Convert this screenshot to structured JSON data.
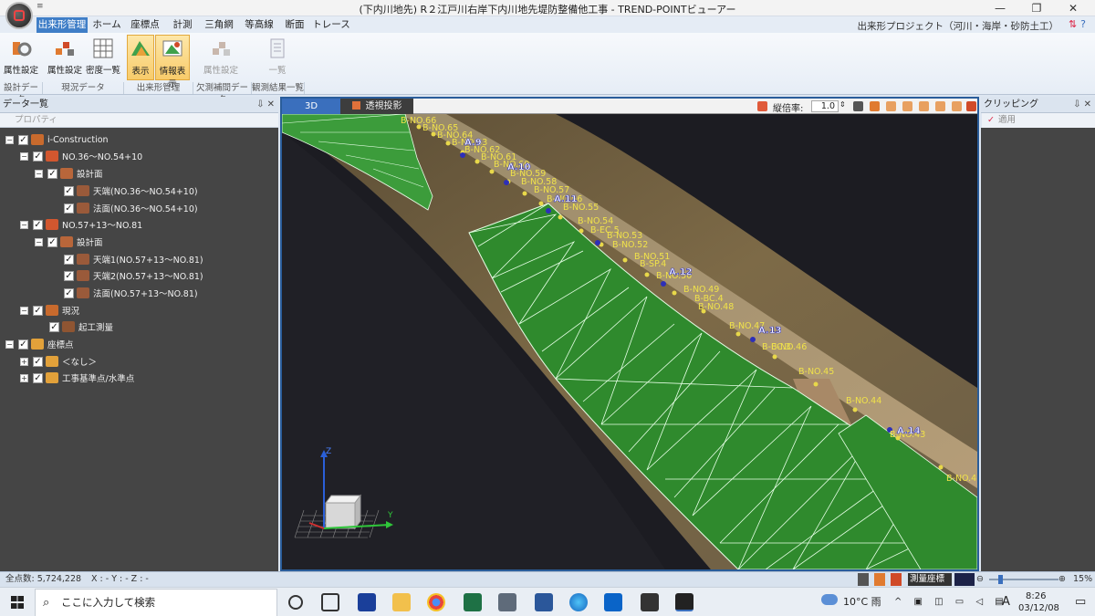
{
  "window": {
    "title": "(下内川地先) R２江戸川右岸下内川地先堤防整備他工事 - TREND-POINTビューアー",
    "qat": "≡",
    "controls": [
      "—",
      "❐",
      "✕"
    ]
  },
  "ribbon_tabs": [
    "出来形管理",
    "ホーム",
    "座標点",
    "計測",
    "三角網",
    "等高線",
    "断面",
    "トレース"
  ],
  "project_label": "出来形プロジェクト（河川・海岸・砂防土工）",
  "ribbon_groups": [
    {
      "label": "設計データ",
      "buttons": [
        "属性設定"
      ]
    },
    {
      "label": "現況データ",
      "buttons": [
        "属性設定",
        "密度一覧"
      ]
    },
    {
      "label": "出来形管理",
      "buttons": [
        "表示",
        "情報表示"
      ]
    },
    {
      "label": "欠測補間データ",
      "buttons": [
        "属性設定"
      ]
    },
    {
      "label": "観測結果一覧",
      "buttons": [
        "一覧"
      ]
    }
  ],
  "left_panel": {
    "title": "データ一覧",
    "subtitle": "プロパティ",
    "tree": [
      {
        "label": "i-Construction",
        "level": 0,
        "expander": "−"
      },
      {
        "label": "NO.36～NO.54+10",
        "level": 1,
        "expander": "−"
      },
      {
        "label": "設計面",
        "level": 2,
        "expander": "−"
      },
      {
        "label": "天端(NO.36～NO.54+10)",
        "level": 3,
        "expander": ""
      },
      {
        "label": "法面(NO.36～NO.54+10)",
        "level": 3,
        "expander": ""
      },
      {
        "label": "NO.57+13～NO.81",
        "level": 1,
        "expander": "−"
      },
      {
        "label": "設計面",
        "level": 2,
        "expander": "−"
      },
      {
        "label": "天端1(NO.57+13～NO.81)",
        "level": 3,
        "expander": ""
      },
      {
        "label": "天端2(NO.57+13～NO.81)",
        "level": 3,
        "expander": ""
      },
      {
        "label": "法面(NO.57+13～NO.81)",
        "level": 3,
        "expander": ""
      },
      {
        "label": "現況",
        "level": 1,
        "expander": "−"
      },
      {
        "label": "起工測量",
        "level": 2,
        "expander": ""
      },
      {
        "label": "座標点",
        "level": 0,
        "expander": "−"
      },
      {
        "label": "＜なし＞",
        "level": 1,
        "expander": "+"
      },
      {
        "label": "工事基準点/水準点",
        "level": 1,
        "expander": "+"
      }
    ]
  },
  "viewport": {
    "tabs": [
      "3D",
      "透視投影"
    ],
    "scale_label": "縦倍率:",
    "scale_value": "1.0",
    "axis_labels": {
      "x": "X",
      "y": "Y",
      "z": "Z"
    },
    "station_labels": [
      "B-NO.66",
      "B-NO.65",
      "B-NO.64",
      "B-NO.63",
      "B-NO.62",
      "B-NO.61",
      "B-NO.60",
      "B-NO.59",
      "B-NO.58",
      "B-NO.57",
      "B-NO.56",
      "B-NO.55",
      "B-NO.54",
      "B-EC.5",
      "B-NO.53",
      "B-NO.52",
      "B-NO.51",
      "B-SP.4",
      "B-NO.50",
      "B-NO.49",
      "B-BC.4",
      "B-NO.48",
      "B-NO.47",
      "B-EC.3",
      "B-NO.46",
      "B-NO.45",
      "B-NO.44",
      "B-NO.43",
      "B-NO.4"
    ],
    "control_points": [
      "A.9",
      "A.10",
      "A.11",
      "A.12",
      "A.13",
      "A.14"
    ]
  },
  "right_panel": {
    "title": "クリッピング",
    "apply_label": "適用"
  },
  "statusbar": {
    "point_count": "全点数: 5,724,228",
    "coords": "X : -   Y : -   Z : -",
    "coord_system": "測量座標系",
    "zoom": "15%"
  },
  "taskbar": {
    "search_placeholder": "ここに入力して検索",
    "weather": "10°C 雨",
    "ime": "A",
    "time": "8:26",
    "date": "03/12/08"
  }
}
